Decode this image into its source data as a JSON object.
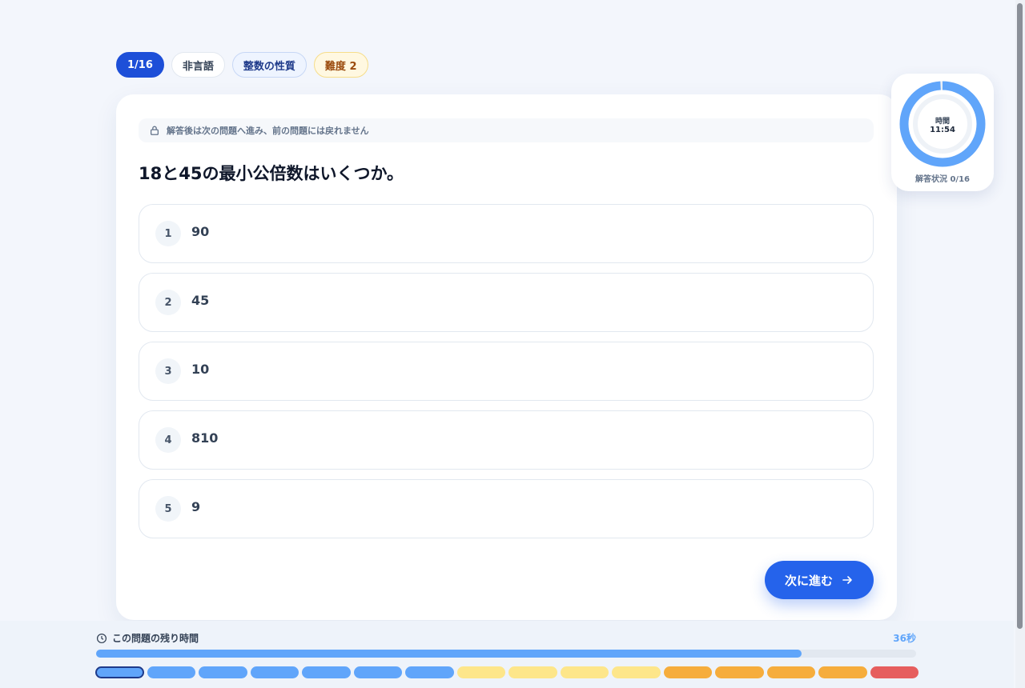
{
  "header": {
    "progress_chip": "1/16",
    "section_chip": "非言語",
    "category_chip": "整数の性質",
    "difficulty_chip": "難度 2"
  },
  "notice": {
    "icon": "lock-icon",
    "text": "解答後は次の問題へ進み、前の問題には戻れません"
  },
  "question": {
    "text": "18と45の最小公倍数はいくつか。",
    "options": [
      {
        "number": "1",
        "text": "90"
      },
      {
        "number": "2",
        "text": "45"
      },
      {
        "number": "3",
        "text": "10"
      },
      {
        "number": "4",
        "text": "810"
      },
      {
        "number": "5",
        "text": "9"
      }
    ]
  },
  "next_button": {
    "label": "次に進む",
    "icon": "arrow-right-icon"
  },
  "timer": {
    "label": "時間",
    "time": "11:54",
    "remaining_fraction": 0.99,
    "answer_status": "解答状況 0/16"
  },
  "question_timer": {
    "label": "この問題の残り時間",
    "seconds": "36秒",
    "remaining_fraction": 0.86
  },
  "question_segments": {
    "current_index": 0,
    "colors": [
      "#60a5fa",
      "#60a5fa",
      "#60a5fa",
      "#60a5fa",
      "#60a5fa",
      "#60a5fa",
      "#60a5fa",
      "#fde68a",
      "#fde68a",
      "#fde68a",
      "#fde68a",
      "#f6ad3c",
      "#f6ad3c",
      "#f6ad3c",
      "#f6ad3c",
      "#e65e5e"
    ]
  },
  "colors": {
    "primary": "#2563eb",
    "accent": "#60a5fa"
  }
}
